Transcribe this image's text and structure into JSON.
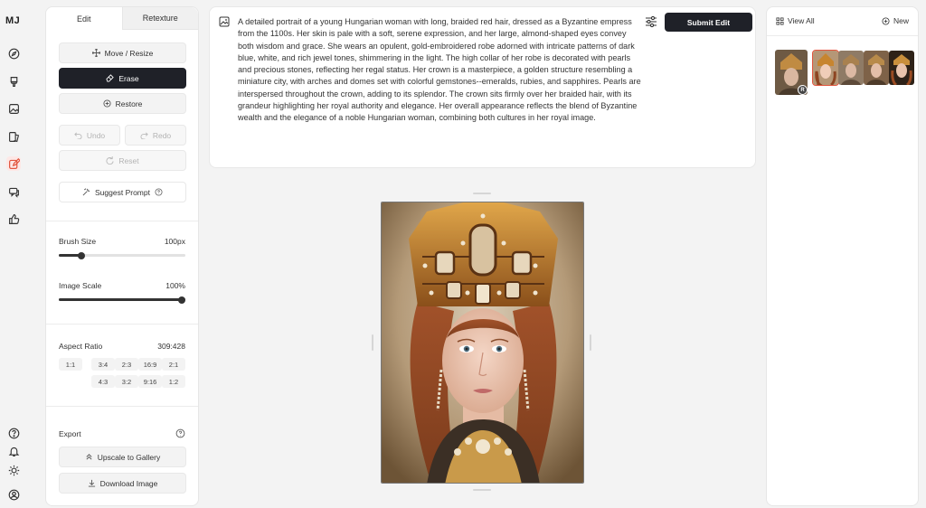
{
  "app": {
    "logo": "MJ"
  },
  "left_panel": {
    "tabs": [
      "Edit",
      "Retexture"
    ],
    "move_resize": "Move / Resize",
    "erase": "Erase",
    "restore": "Restore",
    "undo": "Undo",
    "redo": "Redo",
    "reset": "Reset",
    "suggest_prompt": "Suggest Prompt",
    "brush_size": {
      "label": "Brush Size",
      "value": "100px",
      "fraction": 0.18
    },
    "image_scale": {
      "label": "Image Scale",
      "value": "100%",
      "fraction": 1.0
    },
    "aspect_ratio": {
      "label": "Aspect Ratio",
      "value": "309:428",
      "row1": [
        "1:1",
        "3:4",
        "2:3",
        "16:9",
        "2:1"
      ],
      "row2": [
        "4:3",
        "3:2",
        "9:16",
        "1:2"
      ]
    },
    "export": {
      "label": "Export",
      "upscale": "Upscale to Gallery",
      "download": "Download Image"
    }
  },
  "prompt": {
    "text": "A detailed portrait of a young Hungarian woman with long, braided red hair, dressed as a Byzantine empress from the 1100s. Her skin is pale with a soft, serene expression, and her large, almond-shaped eyes convey both wisdom and grace. She wears an opulent, gold-embroidered robe adorned with intricate patterns of dark blue, white, and rich jewel tones, shimmering in the light. The high collar of her robe is decorated with pearls and precious stones, reflecting her regal status. Her crown is a masterpiece, a golden structure resembling a miniature city, with arches and domes set with colorful gemstones--emeralds, rubies, and sapphires. Pearls are interspersed throughout the crown, adding to its splendor. The crown sits firmly over her braided hair, with its grandeur highlighting her royal authority and elegance. Her overall appearance reflects the blend of Byzantine wealth and the elegance of a noble Hungarian woman, combining both cultures in her royal image.",
    "submit": "Submit Edit"
  },
  "right_panel": {
    "view_all": "View All",
    "new": "New",
    "badge": "R"
  },
  "colors": {
    "accent": "#e2563f",
    "dark_button": "#1f2128"
  }
}
